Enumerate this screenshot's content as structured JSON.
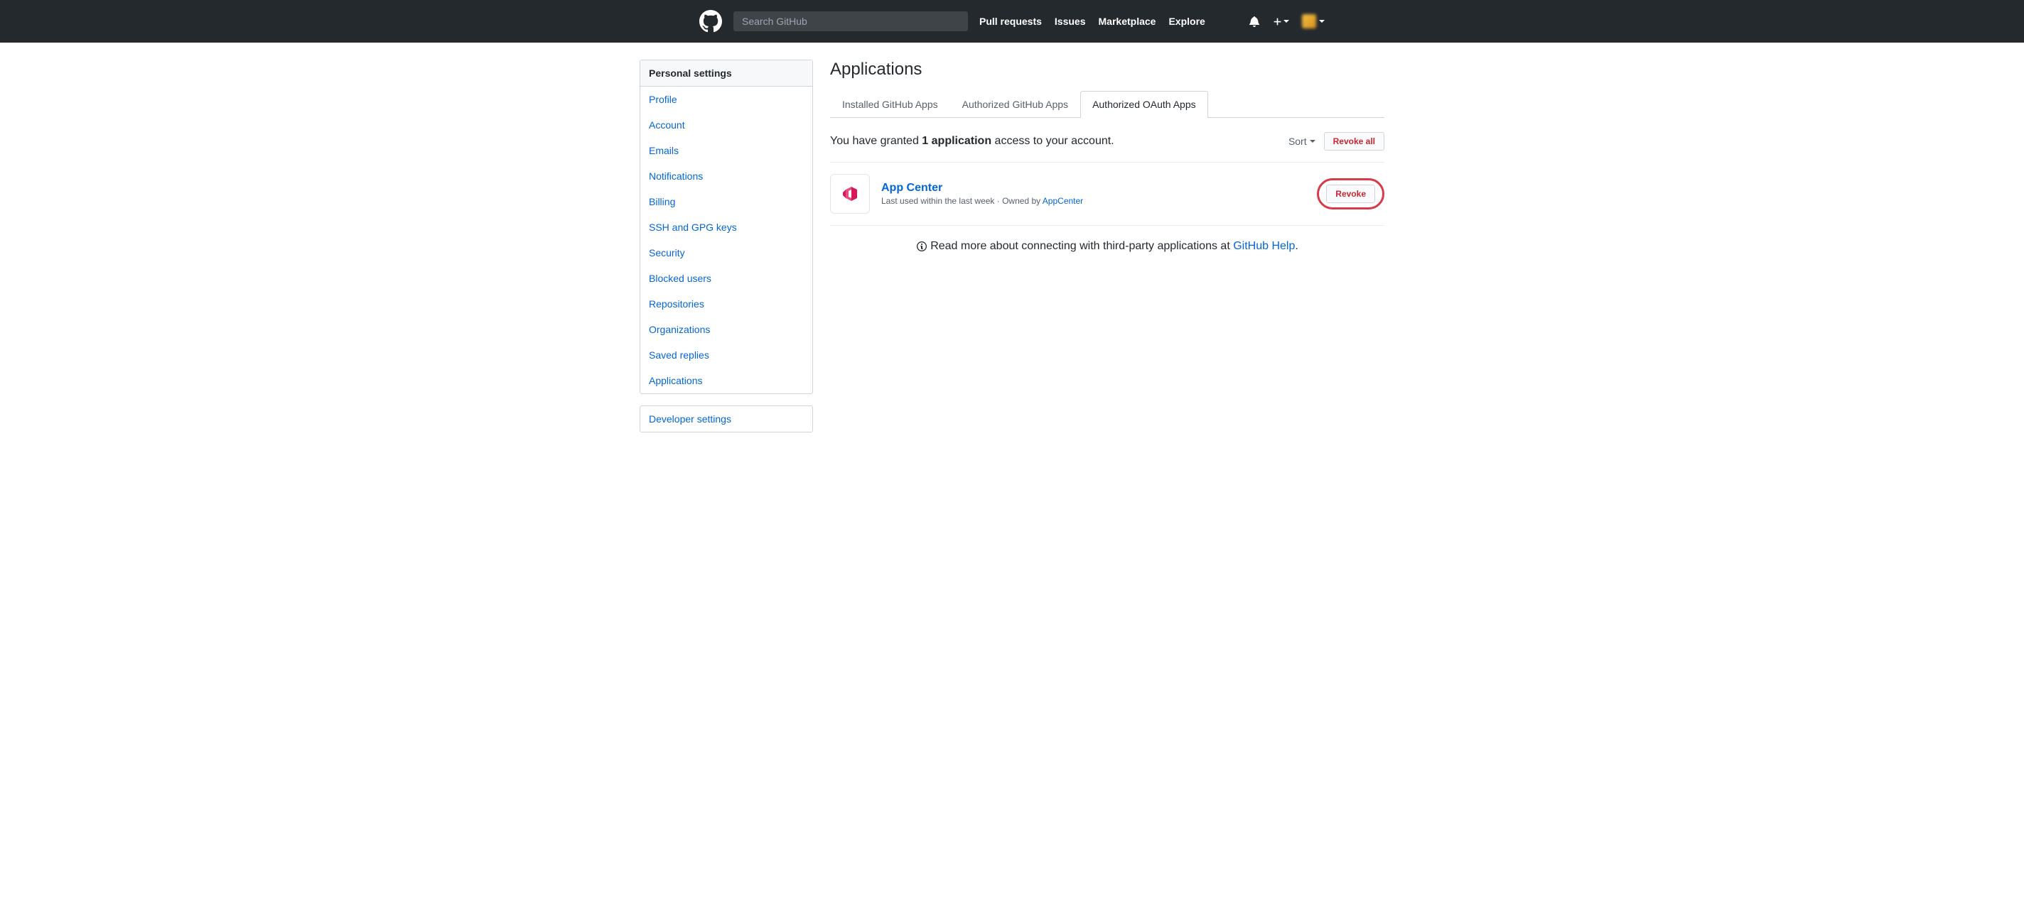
{
  "header": {
    "search_placeholder": "Search GitHub",
    "nav": [
      "Pull requests",
      "Issues",
      "Marketplace",
      "Explore"
    ]
  },
  "sidebar": {
    "heading": "Personal settings",
    "items": [
      "Profile",
      "Account",
      "Emails",
      "Notifications",
      "Billing",
      "SSH and GPG keys",
      "Security",
      "Blocked users",
      "Repositories",
      "Organizations",
      "Saved replies",
      "Applications"
    ],
    "second_heading_items": [
      "Developer settings"
    ]
  },
  "main": {
    "title": "Applications",
    "tabs": [
      {
        "label": "Installed GitHub Apps",
        "selected": false
      },
      {
        "label": "Authorized GitHub Apps",
        "selected": false
      },
      {
        "label": "Authorized OAuth Apps",
        "selected": true
      }
    ],
    "grant_prefix": "You have granted ",
    "grant_count": "1 application",
    "grant_suffix": " access to your account.",
    "sort_label": "Sort",
    "revoke_all_label": "Revoke all",
    "apps": [
      {
        "name": "App Center",
        "meta_prefix": "Last used within the last week · Owned by ",
        "owner": "AppCenter",
        "revoke_label": "Revoke"
      }
    ],
    "footer_prefix": "Read more about connecting with third-party applications at ",
    "footer_link": "GitHub Help",
    "footer_suffix": "."
  }
}
